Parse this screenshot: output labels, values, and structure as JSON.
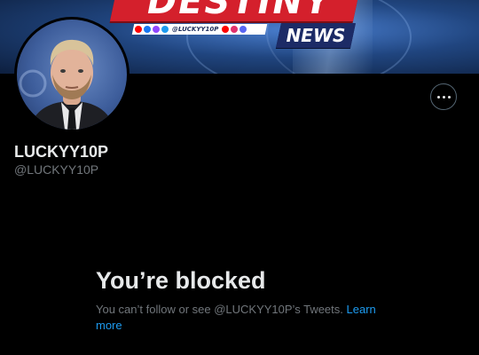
{
  "banner": {
    "logo_text": "DESTINY",
    "social_handle": "@LUCKYY10P",
    "news_label": "NEWS"
  },
  "profile": {
    "display_name": "LUCKYY10P",
    "handle": "@LUCKYY10P",
    "more_icon": "more-horizontal-icon"
  },
  "blocked": {
    "title": "You’re blocked",
    "description": "You can’t follow or see @LUCKYY10P’s Tweets.",
    "link_label": "Learn more"
  },
  "colors": {
    "background": "#000000",
    "text_primary": "#e7e9ea",
    "text_secondary": "#71767b",
    "link": "#1d9bf0",
    "border": "#536471"
  }
}
